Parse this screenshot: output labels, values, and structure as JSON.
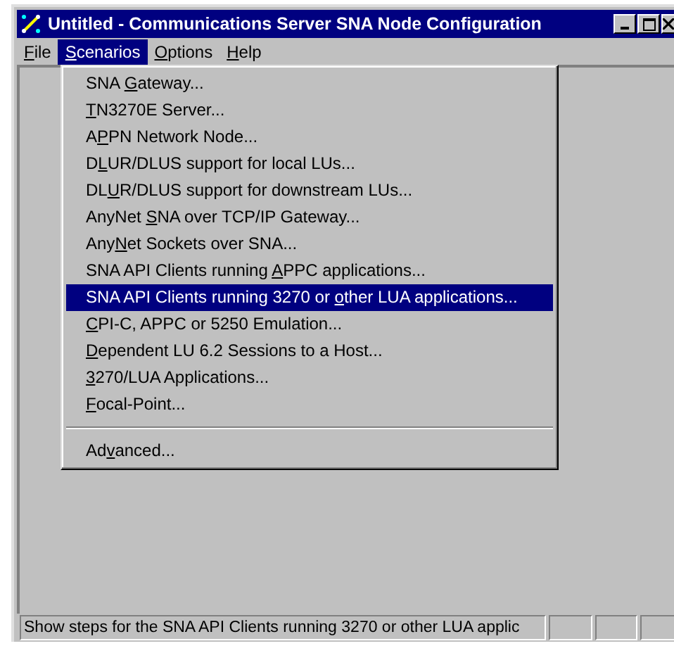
{
  "window": {
    "title": "Untitled - Communications Server SNA Node Configuration"
  },
  "menu_bar": [
    {
      "label": {
        "key": "F",
        "post": "ile"
      },
      "selected": false
    },
    {
      "label": {
        "key": "S",
        "post": "cenarios"
      },
      "selected": true
    },
    {
      "label": {
        "key": "O",
        "post": "ptions"
      },
      "selected": false
    },
    {
      "label": {
        "key": "H",
        "post": "elp"
      },
      "selected": false
    }
  ],
  "dropdown": [
    {
      "kind": "item",
      "label": {
        "pre": "SNA ",
        "key": "G",
        "post": "ateway..."
      },
      "selected": false
    },
    {
      "kind": "item",
      "label": {
        "key": "T",
        "post": "N3270E Server..."
      },
      "selected": false
    },
    {
      "kind": "item",
      "label": {
        "pre": "A",
        "key": "P",
        "post": "PN Network Node..."
      },
      "selected": false
    },
    {
      "kind": "item",
      "label": {
        "pre": "D",
        "key": "L",
        "post": "UR/DLUS support for local LUs..."
      },
      "selected": false
    },
    {
      "kind": "item",
      "label": {
        "pre": "DL",
        "key": "U",
        "post": "R/DLUS support for downstream LUs..."
      },
      "selected": false
    },
    {
      "kind": "item",
      "label": {
        "pre": "AnyNet ",
        "key": "S",
        "post": "NA over TCP/IP Gateway..."
      },
      "selected": false
    },
    {
      "kind": "item",
      "label": {
        "pre": "Any",
        "key": "N",
        "post": "et Sockets over SNA..."
      },
      "selected": false
    },
    {
      "kind": "item",
      "label": {
        "pre": "SNA API Clients running ",
        "key": "A",
        "post": "PPC applications..."
      },
      "selected": false
    },
    {
      "kind": "item",
      "label": {
        "pre": "SNA API Clients running 3270 or ",
        "key": "o",
        "post": "ther LUA applications..."
      },
      "selected": true
    },
    {
      "kind": "item",
      "label": {
        "key": "C",
        "post": "PI-C, APPC or 5250 Emulation..."
      },
      "selected": false
    },
    {
      "kind": "item",
      "label": {
        "key": "D",
        "post": "ependent LU 6.2 Sessions to a Host..."
      },
      "selected": false
    },
    {
      "kind": "item",
      "label": {
        "key": "3",
        "post": "270/LUA Applications..."
      },
      "selected": false
    },
    {
      "kind": "item",
      "label": {
        "key": "F",
        "post": "ocal-Point..."
      },
      "selected": false
    },
    {
      "kind": "separator"
    },
    {
      "kind": "item",
      "label": {
        "pre": "Ad",
        "key": "v",
        "post": "anced..."
      },
      "selected": false
    }
  ],
  "status_bar": {
    "text": "Show steps for the SNA API Clients running 3270 or other LUA applic"
  }
}
